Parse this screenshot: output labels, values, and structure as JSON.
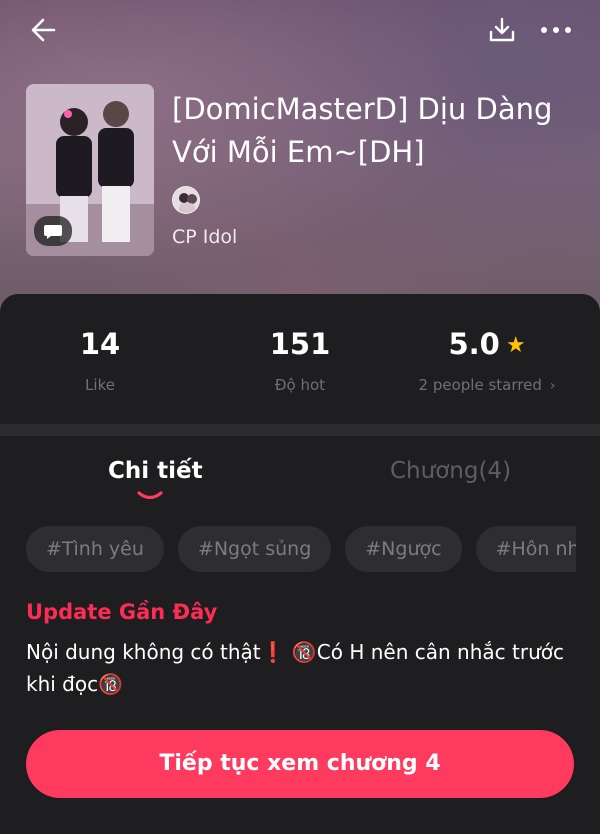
{
  "header": {
    "back_icon": "arrow-left-icon",
    "download_icon": "download-icon",
    "more_icon": "more-horizontal-icon"
  },
  "book": {
    "title": "[DomicMasterD] Dịu Dàng Với Mỗi Em~[DH]",
    "category": "CP Idol"
  },
  "stats": [
    {
      "value": "14",
      "label": "Like"
    },
    {
      "value": "151",
      "label": "Độ hot"
    },
    {
      "value": "5.0",
      "label": "2 people starred"
    }
  ],
  "tabs": [
    {
      "label": "Chi tiết",
      "active": true
    },
    {
      "label": "Chương(4)",
      "active": false
    }
  ],
  "tags": [
    "#Tình yêu",
    "#Ngọt sủng",
    "#Ngược",
    "#Hôn nhân"
  ],
  "update": {
    "title": "Update Gần Đây",
    "body": "Nội dung không có thật❗ 🔞Có H nên cân nhắc trước khi đọc🔞"
  },
  "cta": {
    "label": "Tiếp tục xem chương 4"
  },
  "colors": {
    "accent": "#fe3a5f",
    "accent_text": "#fe2c55",
    "star": "#ffc107",
    "panel_bg": "#1e1e20"
  }
}
